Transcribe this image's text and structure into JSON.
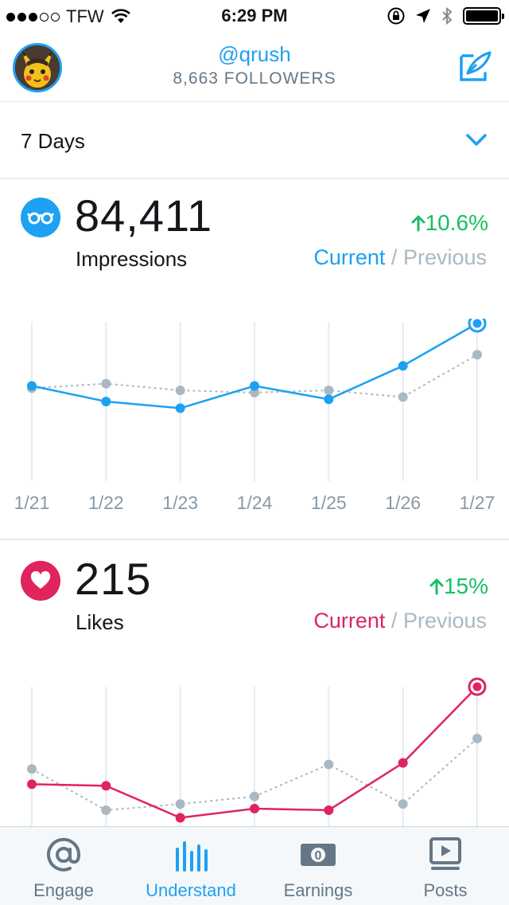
{
  "status_bar": {
    "carrier": "TFW",
    "time": "6:29 PM"
  },
  "header": {
    "handle": "@qrush",
    "followers": "8,663 FOLLOWERS"
  },
  "range": {
    "label": "7 Days"
  },
  "impressions": {
    "value": "84,411",
    "label": "Impressions",
    "change": "10.6%",
    "legend_current": "Current",
    "legend_separator": "/",
    "legend_previous": "Previous",
    "color": "#1da1f2"
  },
  "likes": {
    "value": "215",
    "label": "Likes",
    "change": "15%",
    "legend_current": "Current",
    "legend_separator": "/",
    "legend_previous": "Previous",
    "color": "#e0245e"
  },
  "chart_data": [
    {
      "type": "line",
      "categories": [
        "1/21",
        "1/22",
        "1/23",
        "1/24",
        "1/25",
        "1/26",
        "1/27"
      ],
      "series": [
        {
          "name": "Current",
          "values": [
            62,
            55,
            52,
            62,
            56,
            71,
            90
          ],
          "color": "#1da1f2"
        },
        {
          "name": "Previous",
          "values": [
            61,
            63,
            60,
            59,
            60,
            57,
            76
          ],
          "color": "#aab8c2"
        }
      ],
      "ylim": [
        20,
        90
      ]
    },
    {
      "type": "line",
      "categories": [
        "1/21",
        "1/22",
        "1/23",
        "1/24",
        "1/25",
        "1/26",
        "1/27"
      ],
      "series": [
        {
          "name": "Current",
          "values": [
            14,
            13.5,
            3,
            6,
            5.5,
            21,
            46
          ],
          "color": "#e0245e"
        },
        {
          "name": "Previous",
          "values": [
            19,
            5.5,
            7.5,
            10,
            20.5,
            7.5,
            29
          ],
          "color": "#aab8c2"
        }
      ],
      "ylim": [
        0,
        46
      ]
    }
  ],
  "tabs": [
    {
      "label": "Engage",
      "icon": "at-icon",
      "active": false
    },
    {
      "label": "Understand",
      "icon": "bar-chart-icon",
      "active": true
    },
    {
      "label": "Earnings",
      "icon": "money-icon",
      "active": false
    },
    {
      "label": "Posts",
      "icon": "video-post-icon",
      "active": false
    }
  ]
}
